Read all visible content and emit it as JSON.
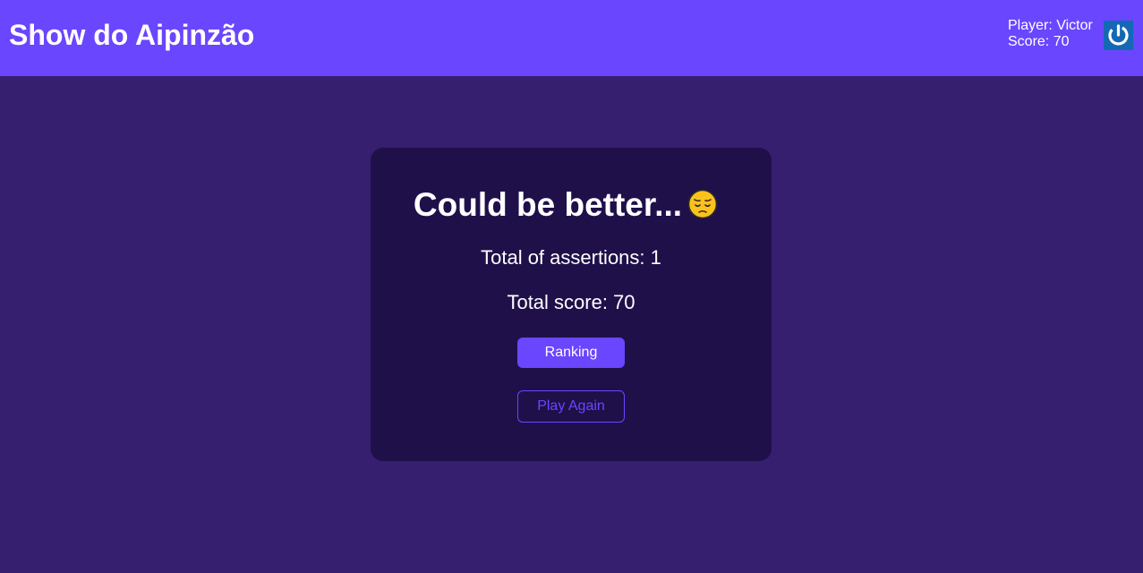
{
  "header": {
    "title": "Show do Aipinzão",
    "player_label": "Player: Victor",
    "score_label": "Score: 70",
    "logout_icon": "power-icon"
  },
  "result": {
    "heading": "Could be better...",
    "emoji": "pensive-face-icon",
    "assertions": "Total of assertions: 1",
    "score": "Total score: 70",
    "ranking_label": "Ranking",
    "play_again_label": "Play Again"
  },
  "colors": {
    "background": "#361f6f",
    "header": "#6a46fe",
    "card": "#1f104a",
    "accent": "#6a46fe",
    "logout_bg": "#1469b4"
  }
}
